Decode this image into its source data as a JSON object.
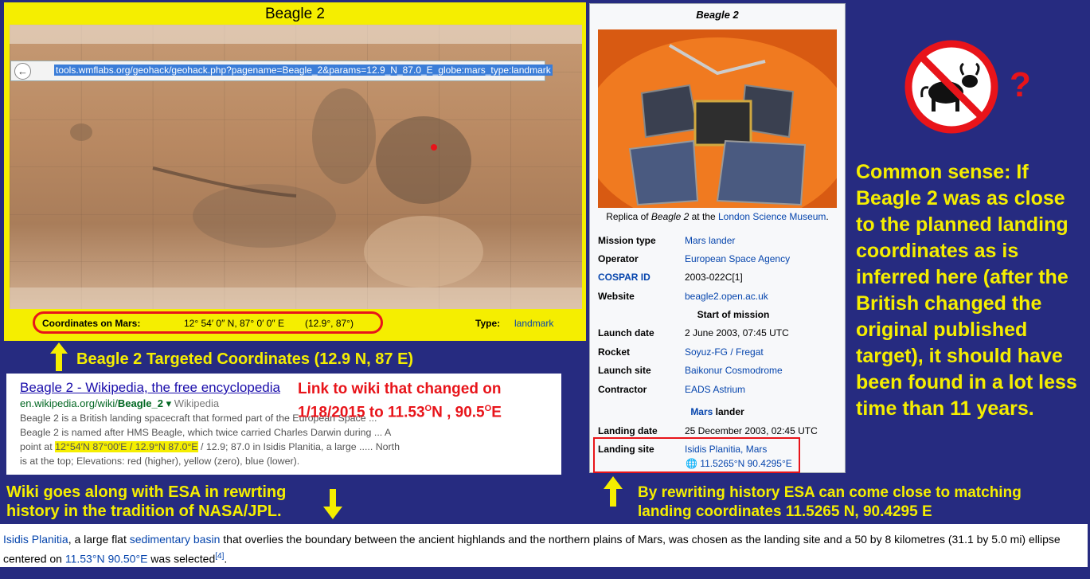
{
  "map": {
    "title": "Beagle 2",
    "url": "tools.wmflabs.org/geohack/geohack.php?pagename=Beagle_2&params=12.9_N_87.0_E_globe:mars_type:landmark",
    "coords_label": "Coordinates on Mars:",
    "coords_value": "12° 54′ 0″ N, 87° 0′ 0″ E",
    "coords_decimal": "(12.9°, 87°)",
    "type_label": "Type:",
    "type_value": "landmark"
  },
  "infobox": {
    "title": "Beagle 2",
    "caption_prefix": "Replica of ",
    "caption_italic": "Beagle 2",
    "caption_mid": " at the ",
    "caption_link": "London Science Museum",
    "caption_end": ".",
    "rows": [
      {
        "label": "Mission type",
        "value": "Mars lander"
      },
      {
        "label": "Operator",
        "value": "European Space Agency"
      },
      {
        "label": "COSPAR ID",
        "value": "2003-022C[1]"
      },
      {
        "label": "Website",
        "value": "beagle2.open.ac.uk"
      },
      {
        "label": "Launch date",
        "value": "2 June 2003, 07:45 UTC"
      },
      {
        "label": "Rocket",
        "value": "Soyuz-FG / Fregat"
      },
      {
        "label": "Launch site",
        "value": "Baikonur Cosmodrome"
      },
      {
        "label": "Contractor",
        "value": "EADS Astrium"
      },
      {
        "label": "Landing date",
        "value": "25 December 2003, 02:45 UTC"
      },
      {
        "label": "Landing site",
        "value": "Isidis Planitia, Mars"
      }
    ],
    "start_header": "Start of mission",
    "mars_header_link": "Mars",
    "mars_header_rest": " lander",
    "landing_coords": "11.5265°N 90.4295°E"
  },
  "annotations": {
    "targeted": "Beagle 2 Targeted Coordinates (12.9 N, 87 E)",
    "common_sense": "Common sense: If Beagle 2 was as close to the planned landing coordinates as is inferred here (after the British changed the original published target), it should have been found in a lot less time than 11 years.",
    "question": "?",
    "link_note_1": "Link to wiki that changed on",
    "link_note_2": "1/18/2015 to 11.53",
    "link_note_3": "N , 90.5",
    "link_note_4": "E",
    "wiki_esa_1": "Wiki goes along with ESA in rewrting",
    "wiki_esa_2": "history in the tradition of NASA/JPL.",
    "rewriting_1": "By rewriting history ESA can come close to matching",
    "rewriting_2": "landing  coordinates  11.5265 N, 90.4295 E"
  },
  "search_result": {
    "title": "Beagle 2 - Wikipedia, the free encyclopedia",
    "url_prefix": "en.wikipedia.org/wiki/",
    "url_bold": "Beagle_2",
    "url_suffix": " Wikipedia",
    "line1": "Beagle 2 is a British landing spacecraft that formed part of the European Space ...",
    "line2": "Beagle 2 is named after HMS Beagle, which twice carried Charles Darwin during ... A",
    "line3_pre": "point at ",
    "line3_hl": "12°54′N 87°00′E / 12.9°N 87.0°E",
    "line3_post": " / 12.9; 87.0 in Isidis Planitia, a large ..... North",
    "line4": "is at the top; Elevations: red (higher), yellow (zero), blue (lower)."
  },
  "bottom": {
    "link1": "Isidis Planitia",
    "text1": ", a large flat ",
    "link2": "sedimentary basin",
    "text2": " that overlies the boundary between the ancient highlands and the northern plains of Mars, was chosen as the landing site and a 50 by 8 kilometres (31.1 by 5.0 mi) ellipse centered on ",
    "link3": "11.53°N 90.50°E",
    "text3": " was selected",
    "ref": "[4]",
    "end": "."
  }
}
